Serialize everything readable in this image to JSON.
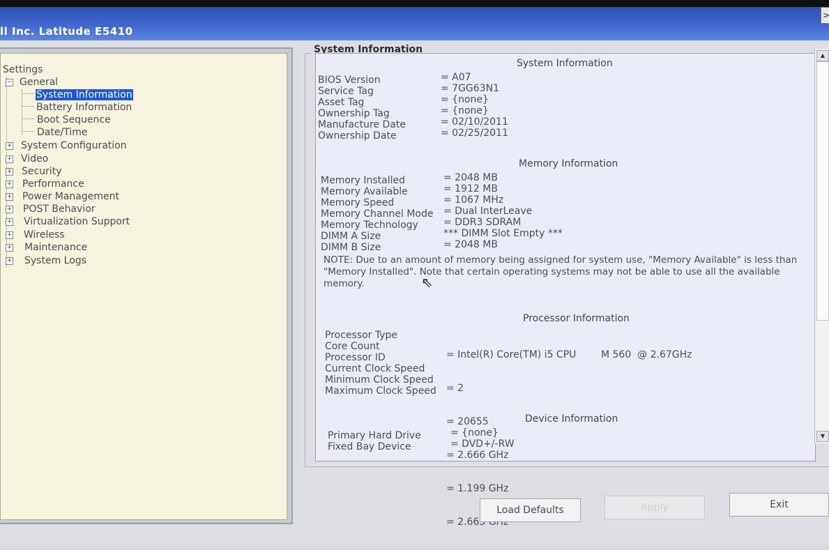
{
  "window": {
    "title": "ll Inc. Latitude E5410",
    "close_label": ">"
  },
  "tree": {
    "root": "Settings",
    "items": [
      {
        "label": "General",
        "expanded": true
      },
      {
        "label": "System Information",
        "selected": true
      },
      {
        "label": "Battery Information"
      },
      {
        "label": "Boot Sequence"
      },
      {
        "label": "Date/Time"
      },
      {
        "label": "System Configuration"
      },
      {
        "label": "Video"
      },
      {
        "label": "Security"
      },
      {
        "label": "Performance"
      },
      {
        "label": "Power Management"
      },
      {
        "label": "POST Behavior"
      },
      {
        "label": "Virtualization Support"
      },
      {
        "label": "Wireless"
      },
      {
        "label": "Maintenance"
      },
      {
        "label": "System Logs"
      }
    ]
  },
  "group_title": "System Information",
  "system": {
    "header": "System Information",
    "rows": [
      {
        "label": "BIOS Version",
        "value": "= A07"
      },
      {
        "label": "Service Tag",
        "value": "= 7GG63N1"
      },
      {
        "label": "Asset Tag",
        "value": "= {none}"
      },
      {
        "label": "Ownership Tag",
        "value": "= {none}"
      },
      {
        "label": "Manufacture Date",
        "value": "= 02/10/2011"
      },
      {
        "label": "Ownership Date",
        "value": "= 02/25/2011"
      }
    ]
  },
  "memory": {
    "header": "Memory Information",
    "rows": [
      {
        "label": "Memory Installed",
        "value": "= 2048 MB"
      },
      {
        "label": "Memory Available",
        "value": "= 1912 MB"
      },
      {
        "label": "Memory Speed",
        "value": "= 1067 MHz"
      },
      {
        "label": "Memory Channel Mode",
        "value": "= Dual InterLeave"
      },
      {
        "label": "Memory Technology",
        "value": "= DDR3 SDRAM"
      },
      {
        "label": "DIMM A Size",
        "value": "*** DIMM Slot Empty ***"
      },
      {
        "label": "DIMM B Size",
        "value": "= 2048 MB"
      }
    ],
    "note": "NOTE: Due to an amount of memory being assigned for system use, \"Memory Available\" is less than \"Memory Installed\". Note that certain operating systems may not be able to use all the available memory."
  },
  "processor": {
    "header": "Processor Information",
    "rows": [
      {
        "label": "Processor Type",
        "value": "= Intel(R) Core(TM) i5 CPU        M 560  @ 2.67GHz"
      },
      {
        "label": "Core Count",
        "value": "= 2"
      },
      {
        "label": "Processor ID",
        "value": "= 20655"
      },
      {
        "label": "Current Clock Speed",
        "value": "= 2.666 GHz"
      },
      {
        "label": "Minimum Clock Speed",
        "value": "= 1.199 GHz"
      },
      {
        "label": "Maximum Clock Speed",
        "value": "= 2.665 GHz"
      }
    ]
  },
  "device": {
    "header": "Device Information",
    "rows": [
      {
        "label": "Primary Hard Drive",
        "value": "= {none}"
      },
      {
        "label": "Fixed Bay Device",
        "value": "= DVD+/-RW"
      }
    ]
  },
  "buttons": {
    "load_defaults": "Load Defaults",
    "apply": "Apply",
    "exit": "Exit"
  }
}
